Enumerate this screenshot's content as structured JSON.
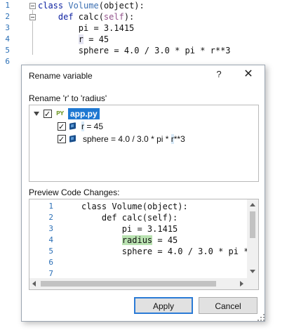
{
  "editor": {
    "lines": [
      {
        "num": "1",
        "tokens": [
          {
            "t": "class ",
            "c": "kw"
          },
          {
            "t": "Volume",
            "c": "cls"
          },
          {
            "t": "(object):",
            "c": ""
          }
        ]
      },
      {
        "num": "2",
        "tokens": [
          {
            "t": "    def ",
            "c": "kw"
          },
          {
            "t": "calc(",
            "c": ""
          },
          {
            "t": "self",
            "c": "slf"
          },
          {
            "t": "):",
            "c": ""
          }
        ]
      },
      {
        "num": "3",
        "tokens": [
          {
            "t": "        pi = 3.1415",
            "c": ""
          }
        ]
      },
      {
        "num": "4",
        "tokens": [
          {
            "t": "        ",
            "c": ""
          },
          {
            "t": "r",
            "c": "hl"
          },
          {
            "t": " = 45",
            "c": ""
          }
        ]
      },
      {
        "num": "5",
        "tokens": [
          {
            "t": "        sphere = 4.0 / 3.0 * pi * r**3",
            "c": ""
          }
        ]
      },
      {
        "num": "6",
        "tokens": []
      }
    ]
  },
  "dialog": {
    "title": "Rename variable",
    "help": "?",
    "close": "✕",
    "rename_label": "Rename 'r' to 'radius'",
    "tree": {
      "file_icon": "PY",
      "file_name": "app.py",
      "items": [
        {
          "pre": "",
          "mark": "r",
          "post": " = 45"
        },
        {
          "pre": "sphere = 4.0 / 3.0 * pi * ",
          "mark": "r",
          "post": "**3"
        }
      ]
    },
    "preview_label": "Preview Code Changes:",
    "preview_lines": [
      {
        "num": "1",
        "tokens": [
          {
            "t": "class Volume(object):",
            "c": ""
          }
        ]
      },
      {
        "num": "2",
        "tokens": [
          {
            "t": "    def calc(self):",
            "c": ""
          }
        ]
      },
      {
        "num": "3",
        "tokens": [
          {
            "t": "        pi = 3.1415",
            "c": ""
          }
        ]
      },
      {
        "num": "4",
        "tokens": [
          {
            "t": "        ",
            "c": ""
          },
          {
            "t": "radius",
            "c": "radius"
          },
          {
            "t": " = 45",
            "c": ""
          }
        ]
      },
      {
        "num": "5",
        "tokens": [
          {
            "t": "        sphere = 4.0 / 3.0 * pi *",
            "c": ""
          }
        ]
      },
      {
        "num": "6",
        "tokens": []
      },
      {
        "num": "7",
        "tokens": []
      }
    ],
    "apply_label": "Apply",
    "cancel_label": "Cancel"
  },
  "colors": {
    "accent": "#1e78d2",
    "line_number": "#2b6fb6",
    "keyword": "#0b1fa0",
    "rename_highlight": "#b9e2b1"
  }
}
